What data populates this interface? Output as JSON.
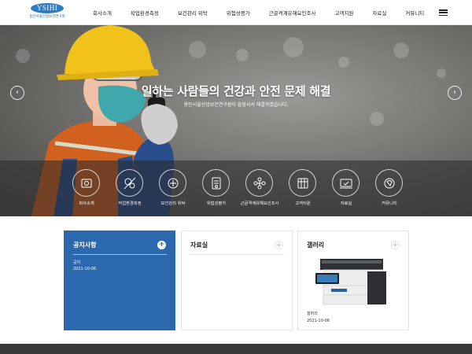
{
  "logo": {
    "text": "YSIHI",
    "subtext": "용인서울산업보건연구원"
  },
  "nav": {
    "items": [
      "회사소개",
      "작업환경측정",
      "보건관리 위탁",
      "위험성평가",
      "근골격계유해요인조사",
      "고객지원",
      "자료실",
      "커뮤니티"
    ]
  },
  "hero": {
    "title": "일하는 사람들의 건강과 안전 문제 해결",
    "subtitle": "용인서울산업보건연구원이 앞장서서 해결하겠습니다."
  },
  "services": [
    {
      "label": "회사소개",
      "icon": "company-icon"
    },
    {
      "label": "작업환경측정",
      "icon": "measurement-icon"
    },
    {
      "label": "보건관리 위탁",
      "icon": "health-management-icon"
    },
    {
      "label": "위험성평가",
      "icon": "risk-assessment-icon"
    },
    {
      "label": "근골격계유해요인조사",
      "icon": "musculoskeletal-icon"
    },
    {
      "label": "고객지원",
      "icon": "customer-support-icon"
    },
    {
      "label": "자료실",
      "icon": "archive-icon"
    },
    {
      "label": "커뮤니티",
      "icon": "community-icon"
    }
  ],
  "notice": {
    "title": "공지사항",
    "item": "공지",
    "date": "2021-10-06"
  },
  "data_room": {
    "title": "자료실"
  },
  "gallery": {
    "title": "갤러리",
    "caption": "갤러리",
    "date": "2021-10-06"
  },
  "colors": {
    "accent": "#2b68ad",
    "footer": "#3a3a3a"
  }
}
